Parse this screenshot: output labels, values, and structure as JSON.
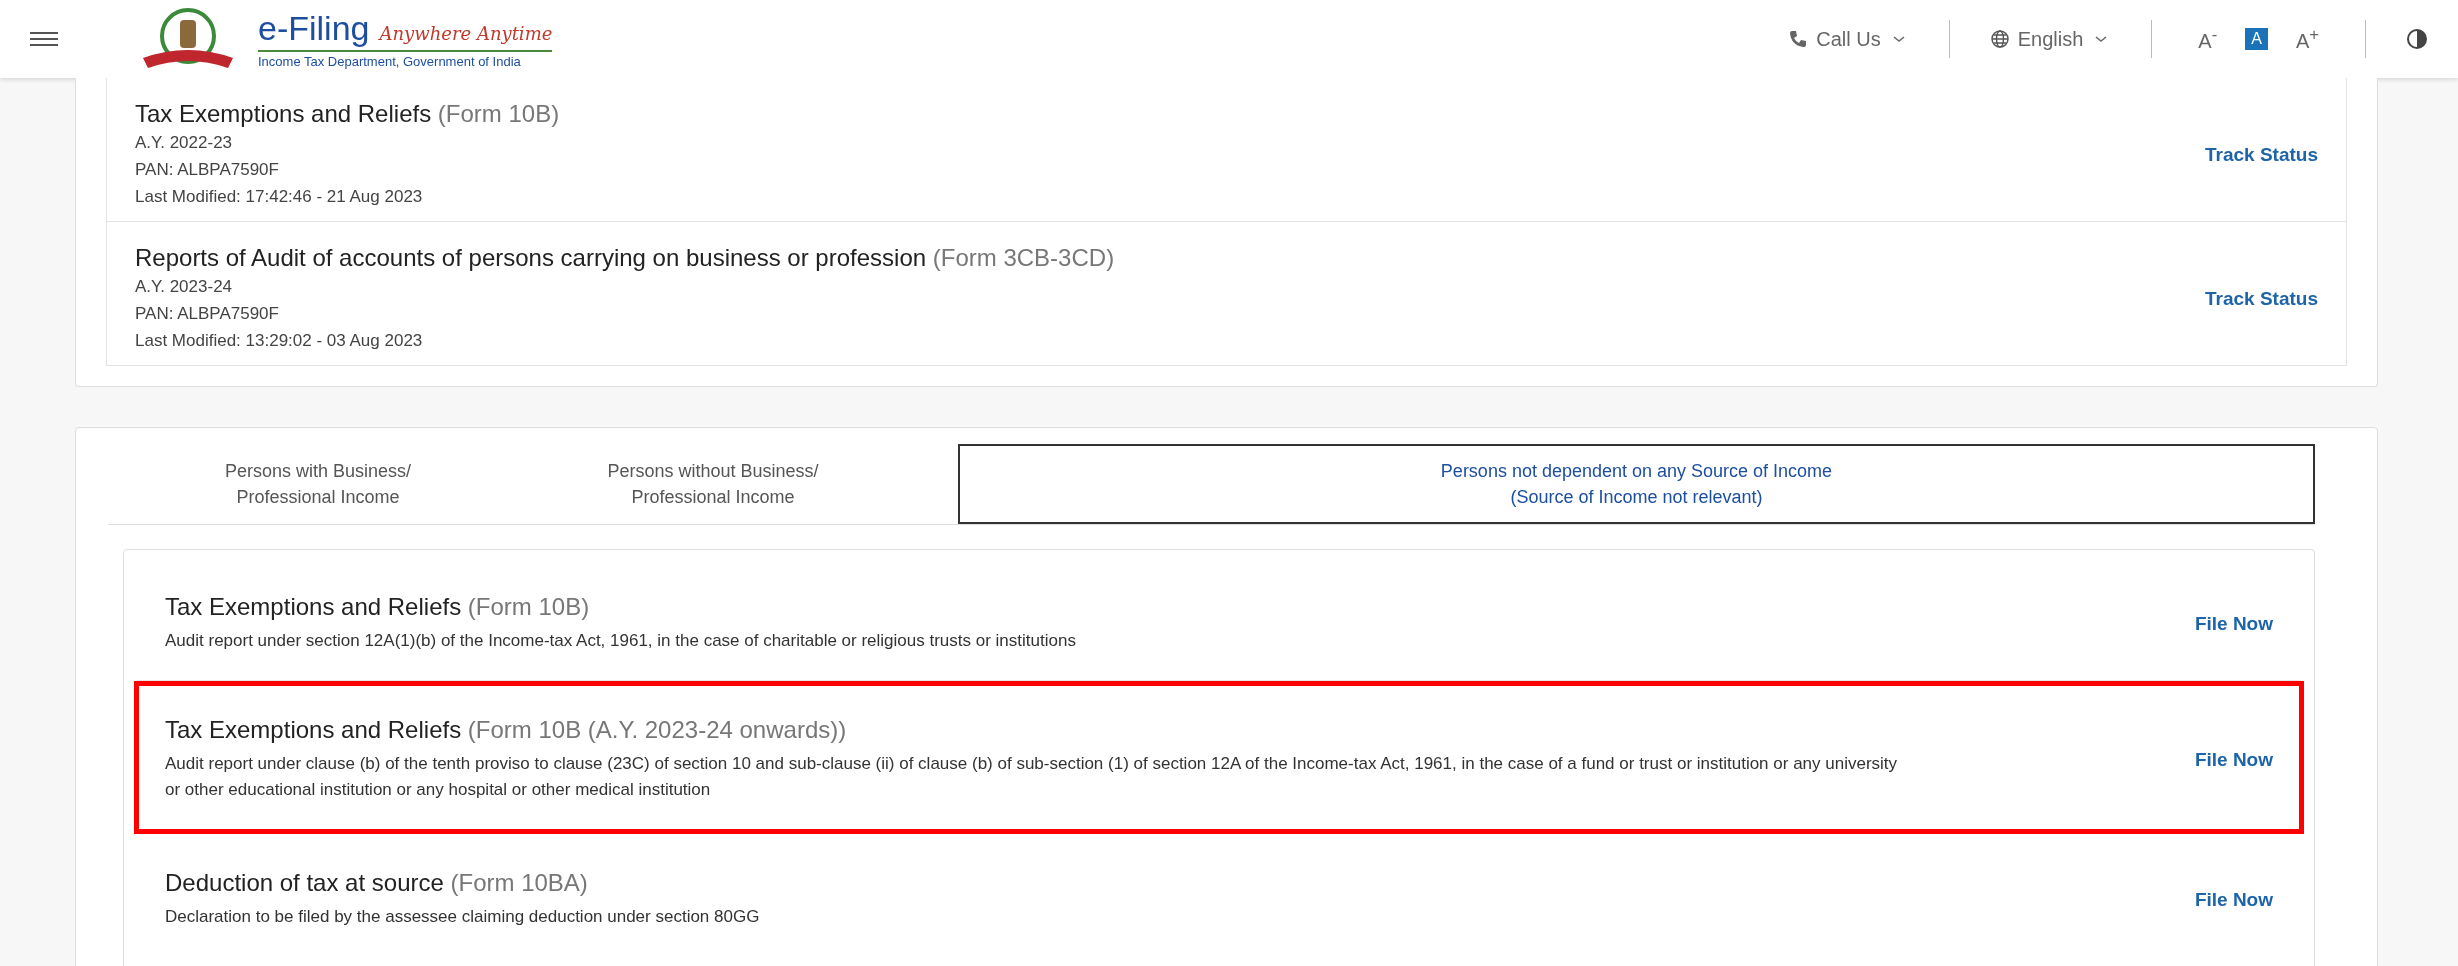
{
  "header": {
    "brand": "e-Filing",
    "tagline": "Anywhere Anytime",
    "subtitle": "Income Tax Department, Government of India",
    "call_us": "Call Us",
    "language": "English",
    "font_sizes": [
      {
        "label": "A",
        "sup": "-",
        "selected": false
      },
      {
        "label": "A",
        "selected": true
      },
      {
        "label": "A",
        "sup": "+",
        "selected": false
      }
    ]
  },
  "filed_forms": [
    {
      "title": "Tax Exemptions and Reliefs",
      "form": "(Form 10B)",
      "ay": "A.Y. 2022-23",
      "pan": "PAN: ALBPA7590F",
      "modified": "Last Modified: 17:42:46 - 21 Aug 2023",
      "action": "Track Status"
    },
    {
      "title": "Reports of Audit of accounts of persons carrying on business or profession",
      "form": "(Form 3CB-3CD)",
      "ay": "A.Y. 2023-24",
      "pan": "PAN: ALBPA7590F",
      "modified": "Last Modified: 13:29:02 - 03 Aug 2023",
      "action": "Track Status"
    }
  ],
  "tabs": [
    {
      "lines": [
        "Persons with Business/",
        "Professional Income"
      ],
      "selected": false
    },
    {
      "lines": [
        "Persons without Business/",
        "Professional Income"
      ],
      "selected": false
    },
    {
      "lines": [
        "Persons not dependent on any Source of Income",
        "(Source of Income not relevant)"
      ],
      "selected": true
    }
  ],
  "forms": [
    {
      "title": "Tax Exemptions and Reliefs",
      "form": "(Form 10B)",
      "description": "Audit report under section 12A(1)(b) of the Income-tax Act, 1961, in the case of charitable or religious trusts or institutions",
      "action": "File Now",
      "highlighted": false
    },
    {
      "title": "Tax Exemptions and Reliefs",
      "form": "(Form 10B (A.Y. 2023-24 onwards))",
      "description": "Audit report under clause (b) of the tenth proviso to clause (23C) of section 10 and sub-clause (ii) of clause (b) of sub-section (1) of section 12A of the Income-tax Act, 1961, in the case of a fund or trust or institution or any university or other educational institution or any hospital or other medical institution",
      "action": "File Now",
      "highlighted": true
    },
    {
      "title": "Deduction of tax at source",
      "form": "(Form 10BA)",
      "description": "Declaration to be filed by the assessee claiming deduction under section 80GG",
      "action": "File Now",
      "highlighted": false
    }
  ]
}
